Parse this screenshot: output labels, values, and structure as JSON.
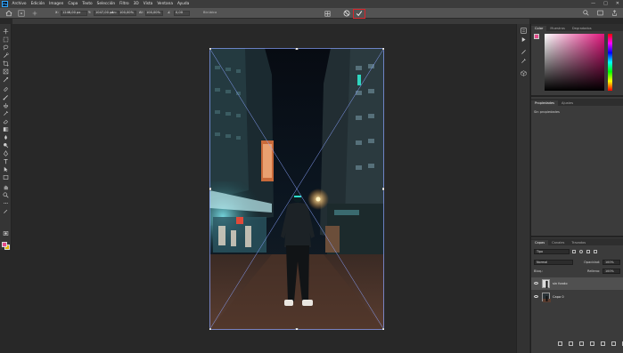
{
  "app": {
    "logo_text": "Ps"
  },
  "menu": {
    "items": [
      "Archivo",
      "Edición",
      "Imagen",
      "Capa",
      "Texto",
      "Selección",
      "Filtro",
      "3D",
      "Vista",
      "Ventana",
      "Ayuda"
    ],
    "window_controls": [
      "—",
      "□",
      "✕"
    ]
  },
  "options_bar": {
    "x_label": "X:",
    "x_value": "1246,00 px",
    "y_label": "Y:",
    "y_value": "1047,00 px",
    "w_label": "An:",
    "w_value": "100,00%",
    "h_label": "Al:",
    "h_value": "100,00%",
    "angle_label": "∠",
    "angle_value": "0,00",
    "interpolation_value": "Bicúbica"
  },
  "right_panels": {
    "color_tabs": [
      "Color",
      "Muestras",
      "Degradados"
    ],
    "properties_tabs": [
      "Propiedades",
      "Ajustes"
    ],
    "properties_empty": "Sin propiedades",
    "layers_tabs": [
      "Capas",
      "Canales",
      "Trazados"
    ],
    "layers_search_placeholder": "Tipo",
    "blend_mode": "Normal",
    "opacity_label": "Opacidad:",
    "opacity_value": "100%",
    "lock_label": "Bloq.:",
    "fill_label": "Relleno:",
    "fill_value": "100%",
    "layers": [
      {
        "name": "sin fondo",
        "selected": true
      },
      {
        "name": "Capa 0",
        "selected": false
      }
    ]
  },
  "colors": {
    "foreground": "#e34c8b",
    "background": "#e2b400",
    "commit_highlight": "#d9252c"
  },
  "icons": [
    "home-icon",
    "cancel-icon",
    "commit-check-icon",
    "warp-icon",
    "search-icon",
    "workspace-icon",
    "share-icon"
  ]
}
